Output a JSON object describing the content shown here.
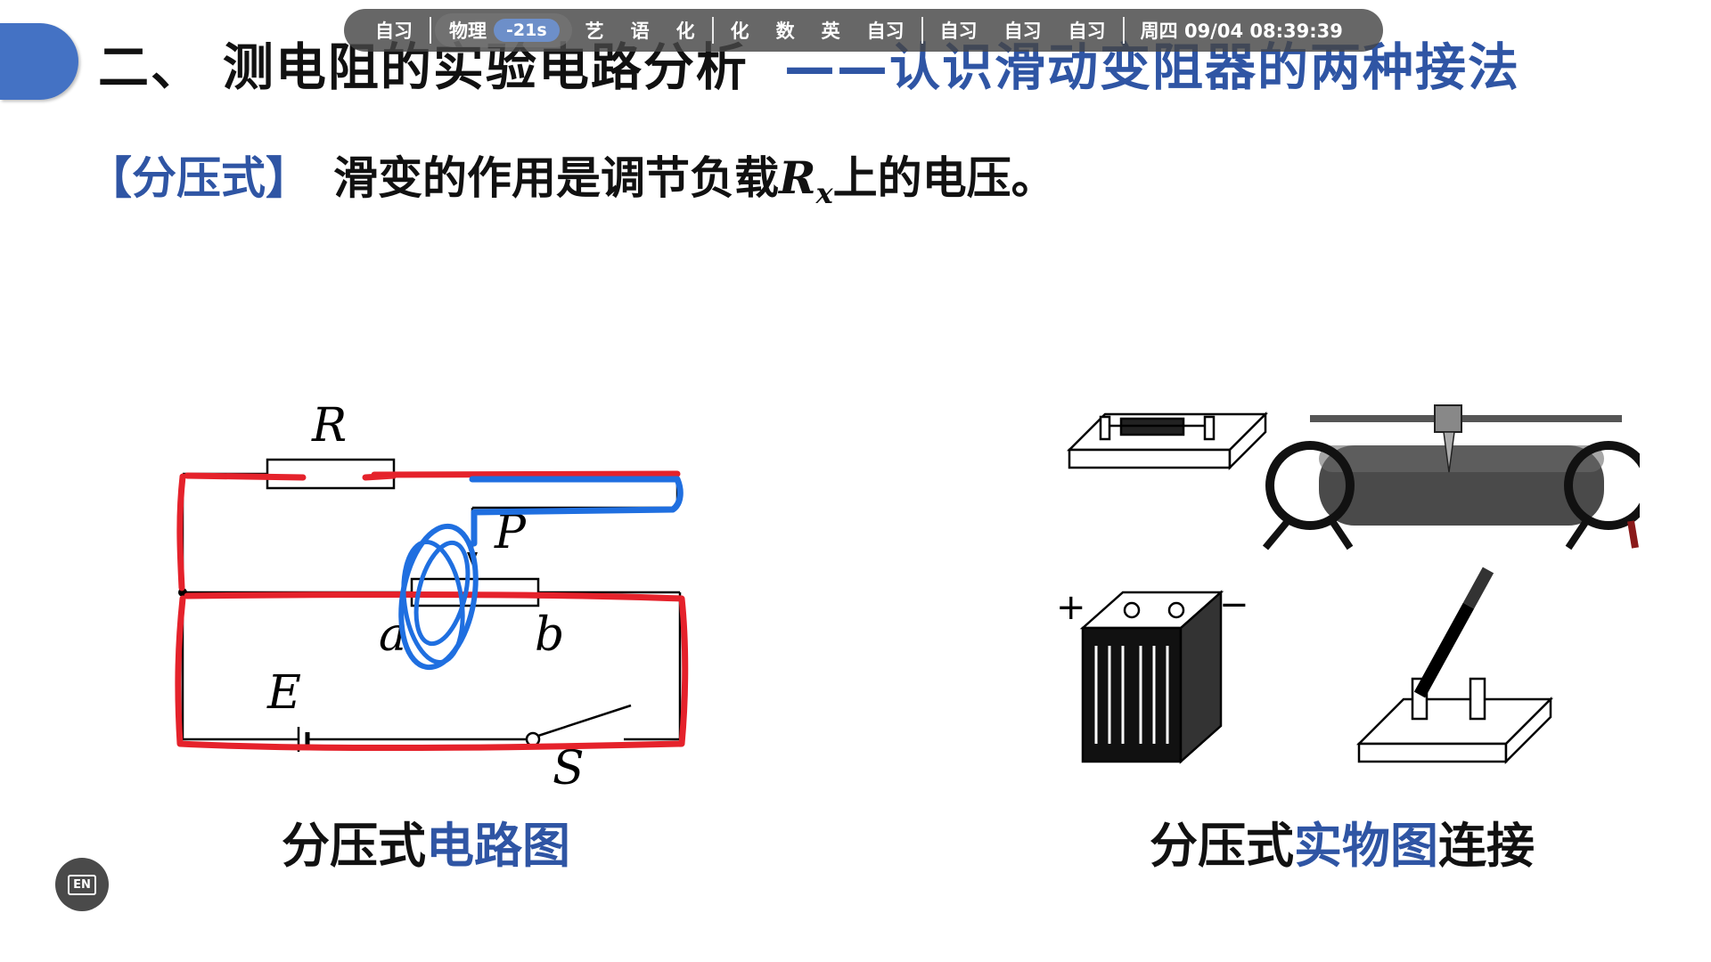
{
  "slide": {
    "title_main": "二、 测电阻的实验电路分析",
    "title_sub": "——认识滑动变阻器的两种接法",
    "tag": "【分压式】",
    "desc_before": "滑变的作用是调节负载",
    "desc_math_var": "R",
    "desc_math_sub": "x",
    "desc_after": "上的电压。",
    "caption_left_black": "分压式",
    "caption_left_blue": "电路图",
    "caption_right_black1": "分压式",
    "caption_right_blue": "实物图",
    "caption_right_black2": "连接"
  },
  "circuit_labels": {
    "resistor": "R",
    "slider": "P",
    "end_a": "a",
    "end_b": "b",
    "source": "E",
    "switch": "S"
  },
  "schedule_bar": {
    "items_before": [
      "自习"
    ],
    "current_subject": "物理",
    "timer": "-21s",
    "items_group1": [
      "艺",
      "语",
      "化"
    ],
    "items_group2": [
      "化",
      "数",
      "英",
      "自习"
    ],
    "items_group3": [
      "自习",
      "自习",
      "自习"
    ],
    "clock": "周四 09/04  08:39:39"
  },
  "lang_button": {
    "label": "EN"
  },
  "colors": {
    "accent_blue": "#2f55a4",
    "annotation_red": "#e5222b",
    "annotation_blue": "#1f6fe0"
  }
}
